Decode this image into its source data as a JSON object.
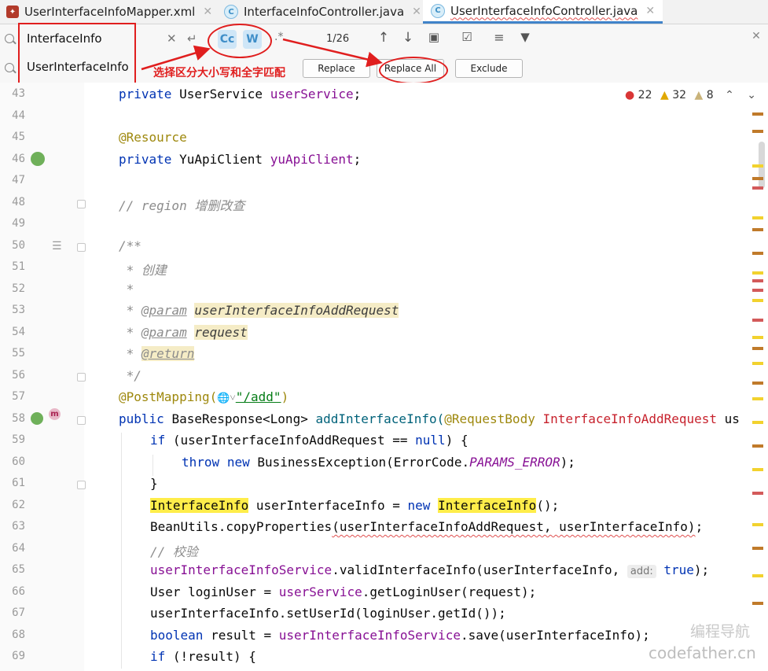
{
  "tabs": [
    {
      "label": "UserInterfaceInfoMapper.xml",
      "icon": "mybatis-bird-icon",
      "active": false
    },
    {
      "label": "InterfaceInfoController.java",
      "icon": "java-class-icon",
      "active": false
    },
    {
      "label": "UserInterfaceInfoController.java",
      "icon": "java-class-icon",
      "active": true
    }
  ],
  "find": {
    "search_value": "InterfaceInfo",
    "replace_value": "UserInterfaceInfo",
    "match_case_label": "Cc",
    "whole_words_label": "W",
    "regex_label": ".*",
    "match_count": "1/26",
    "replace_label": "Replace",
    "replace_all_label": "Replace All",
    "exclude_label": "Exclude"
  },
  "annotation": {
    "text": "选择区分大小写和全字匹配",
    "color": "#e01e1e"
  },
  "inspections": {
    "errors": "22",
    "warnings": "32",
    "weak_warnings": "8"
  },
  "line_numbers": [
    "43",
    "44",
    "45",
    "46",
    "47",
    "48",
    "49",
    "50",
    "51",
    "52",
    "53",
    "54",
    "55",
    "56",
    "57",
    "58",
    "59",
    "60",
    "61",
    "62",
    "63",
    "64",
    "65",
    "66",
    "67",
    "68",
    "69"
  ],
  "code": {
    "l43": {
      "kw": "private",
      "type": "UserService",
      "field": "userService",
      "end": ";"
    },
    "l45": {
      "ann": "@Resource"
    },
    "l46": {
      "kw": "private",
      "type": "YuApiClient",
      "field": "yuApiClient",
      "end": ";"
    },
    "l48": {
      "comment": "// region 增删改查"
    },
    "l50": {
      "comment": "/**"
    },
    "l51": {
      "comment": " * 创建"
    },
    "l52": {
      "comment": " *"
    },
    "l53": {
      "star": " * ",
      "tag": "@param",
      "param": "userInterfaceInfoAddRequest"
    },
    "l54": {
      "star": " * ",
      "tag": "@param",
      "param": "request"
    },
    "l55": {
      "star": " * ",
      "tag": "@return"
    },
    "l56": {
      "comment": " */"
    },
    "l57": {
      "ann": "@PostMapping(",
      "globe": "🌐˅",
      "path": "\"/add\"",
      "close": ")"
    },
    "l58": {
      "kw": "public",
      "ret": "BaseResponse<Long>",
      "method": "addInterfaceInfo(",
      "ann": "@RequestBody",
      "ptype": "InterfaceInfoAddRequest",
      "tail": "us"
    },
    "l59": {
      "kw": "if",
      "mid": " (userInterfaceInfoAddRequest == ",
      "kw2": "null",
      "end": ") {"
    },
    "l60": {
      "kw": "throw",
      "kw2": "new",
      "mid": "BusinessException(ErrorCode.",
      "const": "PARAMS_ERROR",
      "end": ");"
    },
    "l61": {
      "text": "}"
    },
    "l62": {
      "type": "InterfaceInfo",
      "mid": " userInterfaceInfo = ",
      "kw": "new",
      "type2": "InterfaceInfo",
      "end": "();"
    },
    "l63": {
      "pre": "BeanUtils.copyProperties",
      "args": "(userInterfaceInfoAddRequest, userInterfaceInfo)",
      "end": ";"
    },
    "l64": {
      "comment": "// 校验"
    },
    "l65": {
      "field": "userInterfaceInfoService",
      "mid": ".validInterfaceInfo(userInterfaceInfo, ",
      "hint": "add:",
      "kw": "true",
      "end": ");"
    },
    "l66": {
      "pre": "User loginUser = ",
      "field": "userService",
      "end": ".getLoginUser(request);"
    },
    "l67": {
      "text": "userInterfaceInfo.setUserId(loginUser.getId());"
    },
    "l68": {
      "kw": "boolean",
      "mid": " result = ",
      "field": "userInterfaceInfoService",
      "end": ".save(userInterfaceInfo);"
    },
    "l69": {
      "kw": "if",
      "end": " (!result) {"
    }
  },
  "watermark": {
    "line1": "编程导航",
    "line2": "codefather.cn"
  },
  "colors": {
    "keyword": "#0033b3",
    "annotation": "#9e880d",
    "field": "#871094",
    "highlight": "#ffed4a",
    "accent": "#4083c9"
  }
}
